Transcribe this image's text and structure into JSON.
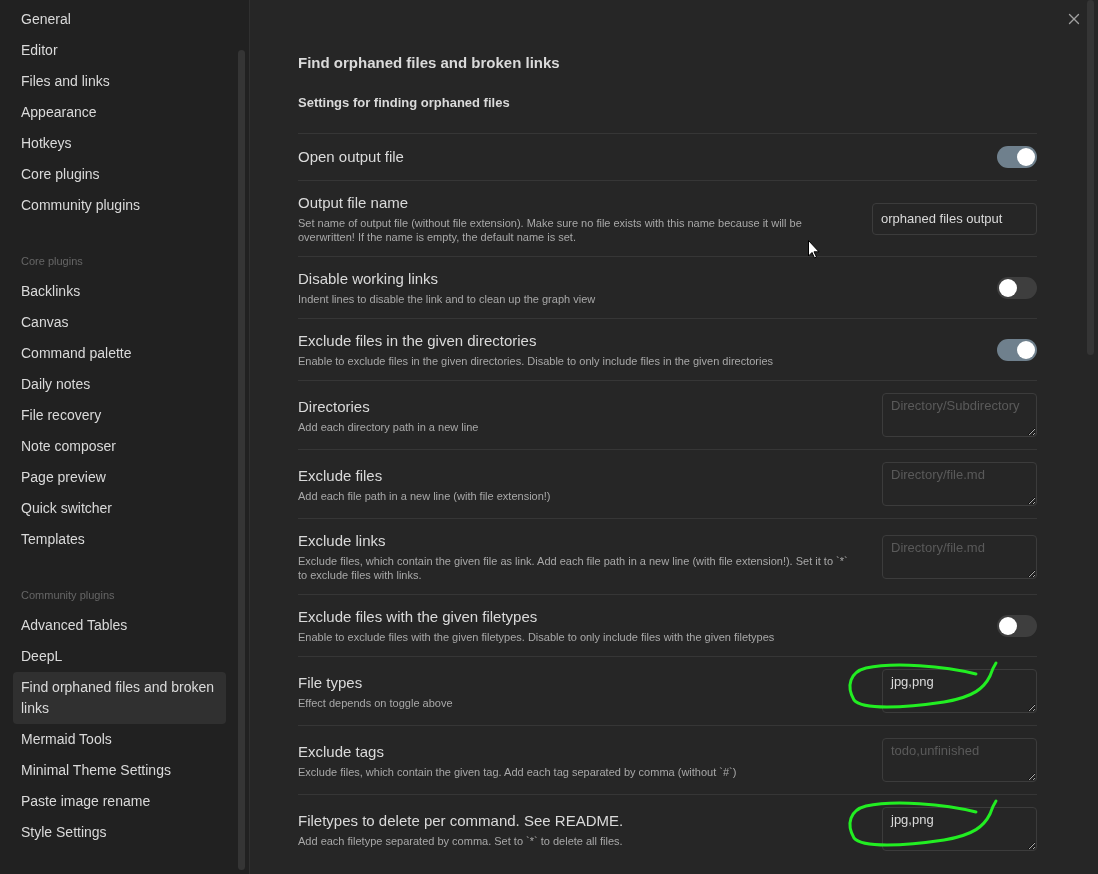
{
  "sidebar": {
    "sections": [
      {
        "items": [
          {
            "label": "General",
            "selected": false
          },
          {
            "label": "Editor",
            "selected": false
          },
          {
            "label": "Files and links",
            "selected": false
          },
          {
            "label": "Appearance",
            "selected": false
          },
          {
            "label": "Hotkeys",
            "selected": false
          },
          {
            "label": "Core plugins",
            "selected": false
          },
          {
            "label": "Community plugins",
            "selected": false
          }
        ]
      },
      {
        "heading": "Core plugins",
        "items": [
          {
            "label": "Backlinks",
            "selected": false
          },
          {
            "label": "Canvas",
            "selected": false
          },
          {
            "label": "Command palette",
            "selected": false
          },
          {
            "label": "Daily notes",
            "selected": false
          },
          {
            "label": "File recovery",
            "selected": false
          },
          {
            "label": "Note composer",
            "selected": false
          },
          {
            "label": "Page preview",
            "selected": false
          },
          {
            "label": "Quick switcher",
            "selected": false
          },
          {
            "label": "Templates",
            "selected": false
          }
        ]
      },
      {
        "heading": "Community plugins",
        "items": [
          {
            "label": "Advanced Tables",
            "selected": false
          },
          {
            "label": "DeepL",
            "selected": false
          },
          {
            "label": "Find orphaned files and broken links",
            "selected": true
          },
          {
            "label": "Mermaid Tools",
            "selected": false
          },
          {
            "label": "Minimal Theme Settings",
            "selected": false
          },
          {
            "label": "Paste image rename",
            "selected": false
          },
          {
            "label": "Style Settings",
            "selected": false
          }
        ]
      }
    ]
  },
  "content": {
    "title": "Find orphaned files and broken links",
    "subtitle": "Settings for finding orphaned files",
    "settings": [
      {
        "kind": "toggle",
        "name": "Open output file",
        "on": true,
        "highlighted": false
      },
      {
        "kind": "text",
        "name": "Output file name",
        "description": "Set name of output file (without file extension). Make sure no file exists with this name because it will be overwritten! If the name is empty, the default name is set.",
        "value": "orphaned files output",
        "highlighted": false
      },
      {
        "kind": "toggle",
        "name": "Disable working links",
        "description": "Indent lines to disable the link and to clean up the graph view",
        "on": false,
        "highlighted": false
      },
      {
        "kind": "toggle",
        "name": "Exclude files in the given directories",
        "description": "Enable to exclude files in the given directories. Disable to only include files in the given directories",
        "on": true,
        "highlighted": false
      },
      {
        "kind": "textarea",
        "name": "Directories",
        "description": "Add each directory path in a new line",
        "placeholder": "Directory/Subdirectory",
        "highlighted": false
      },
      {
        "kind": "textarea",
        "name": "Exclude files",
        "description": "Add each file path in a new line (with file extension!)",
        "placeholder": "Directory/file.md",
        "highlighted": false
      },
      {
        "kind": "textarea",
        "name": "Exclude links",
        "description": "Exclude files, which contain the given file as link. Add each file path in a new line (with file extension!). Set it to `*` to exclude files with links.",
        "placeholder": "Directory/file.md",
        "highlighted": false
      },
      {
        "kind": "toggle",
        "name": "Exclude files with the given filetypes",
        "description": "Enable to exclude files with the given filetypes. Disable to only include files with the given filetypes",
        "on": false,
        "highlighted": false
      },
      {
        "kind": "textarea",
        "name": "File types",
        "description": "Effect depends on toggle above",
        "value": "jpg,png",
        "highlighted": true
      },
      {
        "kind": "textarea",
        "name": "Exclude tags",
        "description": "Exclude files, which contain the given tag. Add each tag separated by comma (without `#`)",
        "placeholder": "todo,unfinished",
        "highlighted": false
      },
      {
        "kind": "textarea",
        "name": "Filetypes to delete per command. See README.",
        "description": "Add each filetype separated by comma. Set to `*` to delete all files.",
        "value": "jpg,png",
        "highlighted": true
      }
    ]
  }
}
